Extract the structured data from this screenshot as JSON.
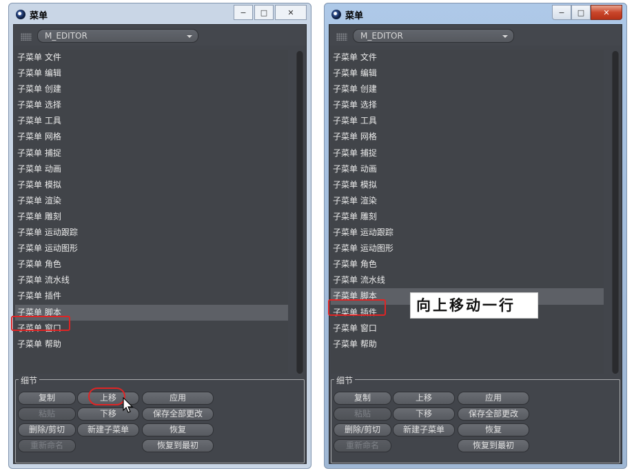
{
  "windows": [
    {
      "title": "菜单",
      "dropdown_value": "M_EDITOR",
      "items": [
        "子菜单 文件",
        "子菜单 编辑",
        "子菜单 创建",
        "子菜单 选择",
        "子菜单 工具",
        "子菜单 网格",
        "子菜单 捕捉",
        "子菜单 动画",
        "子菜单 模拟",
        "子菜单 渲染",
        "子菜单 雕刻",
        "子菜单 运动跟踪",
        "子菜单 运动图形",
        "子菜单 角色",
        "子菜单 流水线",
        "子菜单 插件",
        "子菜单 脚本",
        "子菜单 窗口",
        "子菜单 帮助"
      ],
      "selected_item": "子菜单 脚本"
    },
    {
      "title": "菜单",
      "dropdown_value": "M_EDITOR",
      "items": [
        "子菜单 文件",
        "子菜单 编辑",
        "子菜单 创建",
        "子菜单 选择",
        "子菜单 工具",
        "子菜单 网格",
        "子菜单 捕捉",
        "子菜单 动画",
        "子菜单 模拟",
        "子菜单 渲染",
        "子菜单 雕刻",
        "子菜单 运动跟踪",
        "子菜单 运动图形",
        "子菜单 角色",
        "子菜单 流水线",
        "子菜单 脚本",
        "子菜单 插件",
        "子菜单 窗口",
        "子菜单 帮助"
      ],
      "selected_item": "子菜单 脚本"
    }
  ],
  "details": {
    "label": "细节",
    "copy": "复制",
    "move_up": "上移",
    "apply": "应用",
    "paste": "粘贴",
    "move_down": "下移",
    "save_all": "保存全部更改",
    "delete_cut": "删除/剪切",
    "new_submenu": "新建子菜单",
    "restore": "恢复",
    "rename": "重新命名",
    "restore_initial": "恢复到最初"
  },
  "annotation": "向上移动一行",
  "colors": {
    "highlight": "#e02424",
    "panel": "#42454b",
    "selected_row": "#5d6066"
  }
}
